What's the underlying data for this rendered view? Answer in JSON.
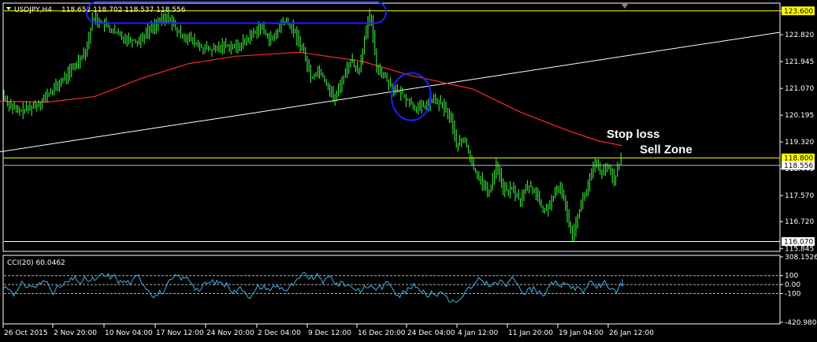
{
  "chart_data": [
    {
      "type": "candlestick",
      "symbol_label": "USDJPY,H4",
      "ohlc_label": "118.652 118.702 118.537 118.556",
      "ylim": [
        115.8,
        123.8
      ],
      "y_ticks": [
        "123.600",
        "122.820",
        "121.945",
        "121.070",
        "120.195",
        "119.320",
        "118.445",
        "117.570",
        "116.720",
        "115.845"
      ],
      "x_ticks": [
        "26 Oct 2015",
        "2 Nov 20:00",
        "10 Nov 04:00",
        "17 Nov 12:00",
        "24 Nov 20:00",
        "2 Dec 04:00",
        "9 Dec 12:00",
        "16 Dec 20:00",
        "24 Dec 04:00",
        "4 Jan 12:00",
        "11 Jan 20:00",
        "19 Jan 04:00",
        "26 Jan 12:00"
      ],
      "price_path": [
        [
          0,
          121.0
        ],
        [
          10,
          120.6
        ],
        [
          22,
          120.3
        ],
        [
          35,
          120.4
        ],
        [
          50,
          120.6
        ],
        [
          62,
          120.9
        ],
        [
          78,
          121.3
        ],
        [
          95,
          121.8
        ],
        [
          110,
          122.4
        ],
        [
          118,
          123.4
        ],
        [
          130,
          123.2
        ],
        [
          145,
          122.9
        ],
        [
          160,
          122.7
        ],
        [
          175,
          122.6
        ],
        [
          190,
          123.0
        ],
        [
          205,
          123.3
        ],
        [
          215,
          123.4
        ],
        [
          225,
          122.9
        ],
        [
          240,
          122.7
        ],
        [
          255,
          122.4
        ],
        [
          270,
          122.3
        ],
        [
          285,
          122.5
        ],
        [
          300,
          122.4
        ],
        [
          315,
          122.7
        ],
        [
          330,
          123.1
        ],
        [
          345,
          122.6
        ],
        [
          360,
          123.3
        ],
        [
          372,
          123.0
        ],
        [
          385,
          122.3
        ],
        [
          395,
          121.4
        ],
        [
          405,
          121.7
        ],
        [
          415,
          121.2
        ],
        [
          425,
          120.7
        ],
        [
          435,
          121.4
        ],
        [
          445,
          122.0
        ],
        [
          455,
          121.6
        ],
        [
          462,
          122.6
        ],
        [
          470,
          123.5
        ],
        [
          478,
          121.8
        ],
        [
          490,
          121.4
        ],
        [
          500,
          121.0
        ],
        [
          510,
          120.9
        ],
        [
          520,
          120.6
        ],
        [
          530,
          120.4
        ],
        [
          540,
          120.5
        ],
        [
          550,
          120.7
        ],
        [
          562,
          120.5
        ],
        [
          572,
          120.1
        ],
        [
          580,
          119.2
        ],
        [
          590,
          119.4
        ],
        [
          600,
          118.5
        ],
        [
          610,
          118.1
        ],
        [
          620,
          117.6
        ],
        [
          630,
          118.6
        ],
        [
          640,
          117.7
        ],
        [
          650,
          117.8
        ],
        [
          660,
          117.4
        ],
        [
          670,
          117.9
        ],
        [
          680,
          117.7
        ],
        [
          690,
          117.0
        ],
        [
          700,
          117.4
        ],
        [
          712,
          117.9
        ],
        [
          720,
          116.9
        ],
        [
          727,
          116.3
        ],
        [
          735,
          117.1
        ],
        [
          745,
          117.8
        ],
        [
          755,
          118.6
        ],
        [
          765,
          118.3
        ],
        [
          772,
          118.5
        ],
        [
          780,
          118.1
        ],
        [
          790,
          118.9
        ]
      ],
      "moving_average": {
        "color": "#ff2a2a",
        "points": [
          [
            0,
            120.65
          ],
          [
            60,
            120.62
          ],
          [
            120,
            120.8
          ],
          [
            180,
            121.4
          ],
          [
            240,
            121.88
          ],
          [
            300,
            122.12
          ],
          [
            380,
            122.25
          ],
          [
            460,
            121.95
          ],
          [
            520,
            121.5
          ],
          [
            600,
            121.05
          ],
          [
            660,
            120.3
          ],
          [
            720,
            119.7
          ],
          [
            760,
            119.35
          ],
          [
            790,
            119.2
          ]
        ]
      },
      "trendline": {
        "color": "#ffffff",
        "from": [
          0,
          119.0
        ],
        "to": [
          990,
          122.9
        ]
      },
      "hlines": [
        {
          "value": 123.6,
          "color": "#ffff00",
          "tag": "123.600",
          "tag_bg": "#ffff00"
        },
        {
          "value": 118.8,
          "color": "#ffff00",
          "tag": "118.800",
          "tag_bg": "#ffff00"
        },
        {
          "value": 118.556,
          "color": "#c0c0c0",
          "tag": "118.556",
          "tag_bg": "#ffffff"
        },
        {
          "value": 116.07,
          "color": "#ffffff",
          "tag": "116.070",
          "tag_bg": "#ffffff"
        }
      ],
      "annotations": [
        {
          "text": "Stop loss",
          "at": [
            770,
            119.45
          ]
        },
        {
          "text": "Sell Zone",
          "at": [
            812,
            118.95
          ]
        }
      ],
      "highlights": [
        {
          "shape": "capsule",
          "color": "#2020ff",
          "from": [
            110,
            123.9
          ],
          "to": [
            490,
            123.2
          ]
        },
        {
          "shape": "circle",
          "color": "#2020ff",
          "center": [
            522,
            120.8
          ],
          "rx": 25,
          "ry": 30
        }
      ],
      "line_color": "#3fff3f"
    },
    {
      "type": "line",
      "label": "CCI(20) 60.0462",
      "ylim": [
        -420.9801,
        308.1526
      ],
      "y_ticks": [
        "308.1526",
        "100",
        "0.00",
        "-100",
        "-420.9801"
      ],
      "levels": [
        100,
        0,
        -100
      ],
      "color": "#40b0e0",
      "last_value": 60.0462
    }
  ]
}
